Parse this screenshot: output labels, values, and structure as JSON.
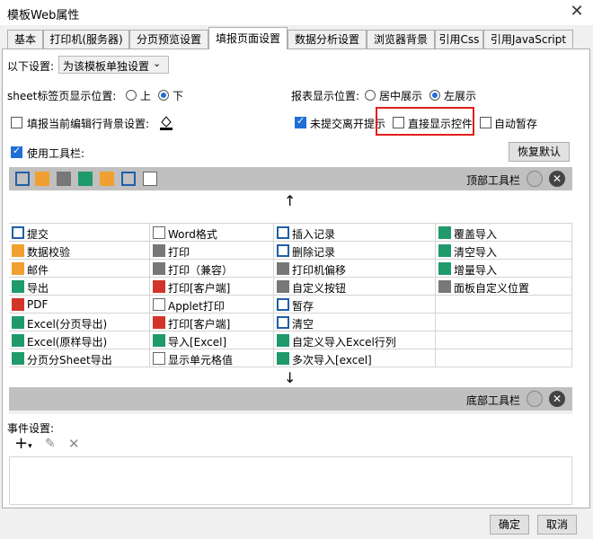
{
  "window": {
    "title": "模板Web属性",
    "close_glyph": "✕"
  },
  "tabs": [
    "基本",
    "打印机(服务器)",
    "分页预览设置",
    "填报页面设置",
    "数据分析设置",
    "浏览器背景",
    "引用Css",
    "引用JavaScript"
  ],
  "settings": {
    "apply_label": "以下设置:",
    "apply_value": "为该模板单独设置",
    "sheet_pos_label": "sheet标签页显示位置:",
    "sheet_top": "上",
    "sheet_bottom": "下",
    "report_pos_label": "报表显示位置:",
    "center": "居中展示",
    "left": "左展示",
    "fill_bg": "填报当前编辑行背景设置:",
    "unsaved_prompt": "未提交离开提示",
    "direct_show": "直接显示控件",
    "auto_save": "自动暂存",
    "use_toolbar": "使用工具栏:",
    "restore": "恢复默认"
  },
  "top_toolbar_label": "顶部工具栏",
  "bottom_toolbar_label": "底部工具栏",
  "arrow_up": "↑",
  "arrow_down": "↓",
  "buttons": [
    [
      "提交",
      "Word格式",
      "插入记录",
      "覆盖导入"
    ],
    [
      "数据校验",
      "打印",
      "删除记录",
      "清空导入"
    ],
    [
      "邮件",
      "打印（兼容）",
      "打印机偏移",
      "增量导入"
    ],
    [
      "导出",
      "打印[客户端]",
      "自定义按钮",
      "面板自定义位置"
    ],
    [
      "PDF",
      "Applet打印",
      "暂存",
      ""
    ],
    [
      "Excel(分页导出)",
      "打印[客户端]",
      "清空",
      ""
    ],
    [
      "Excel(原样导出)",
      "导入[Excel]",
      "自定义导入Excel行列",
      ""
    ],
    [
      "分页分Sheet导出",
      "显示单元格值",
      "多次导入[excel]",
      ""
    ]
  ],
  "events_label": "事件设置:",
  "ok": "确定",
  "cancel": "取消"
}
